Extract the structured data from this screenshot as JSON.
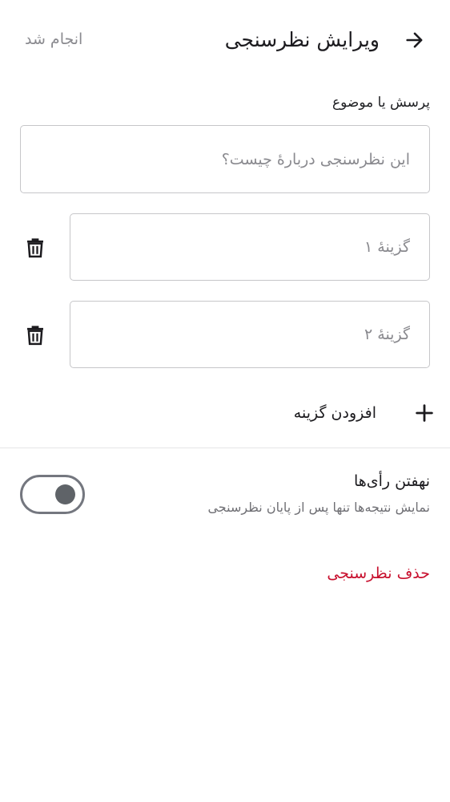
{
  "header": {
    "title": "ویرایش نظرسنجی",
    "done_label": "انجام شد",
    "back_icon": "arrow-right-icon"
  },
  "question": {
    "label": "پرسش یا موضوع",
    "value": "",
    "placeholder": "این نظرسنجی دربارهٔ چیست؟"
  },
  "options": [
    {
      "value": "",
      "placeholder": "گزینهٔ ۱",
      "delete_icon": "trash-icon"
    },
    {
      "value": "",
      "placeholder": "گزینهٔ ۲",
      "delete_icon": "trash-icon"
    }
  ],
  "add_option": {
    "label": "افزودن گزینه",
    "icon": "plus-icon"
  },
  "hide_votes": {
    "title": "نهفتن رأی‌ها",
    "subtitle": "نمایش نتیجه‌ها تنها پس از پایان نظرسنجی",
    "enabled": false
  },
  "delete_poll": {
    "label": "حذف نظرسنجی",
    "color": "#c8102e"
  }
}
